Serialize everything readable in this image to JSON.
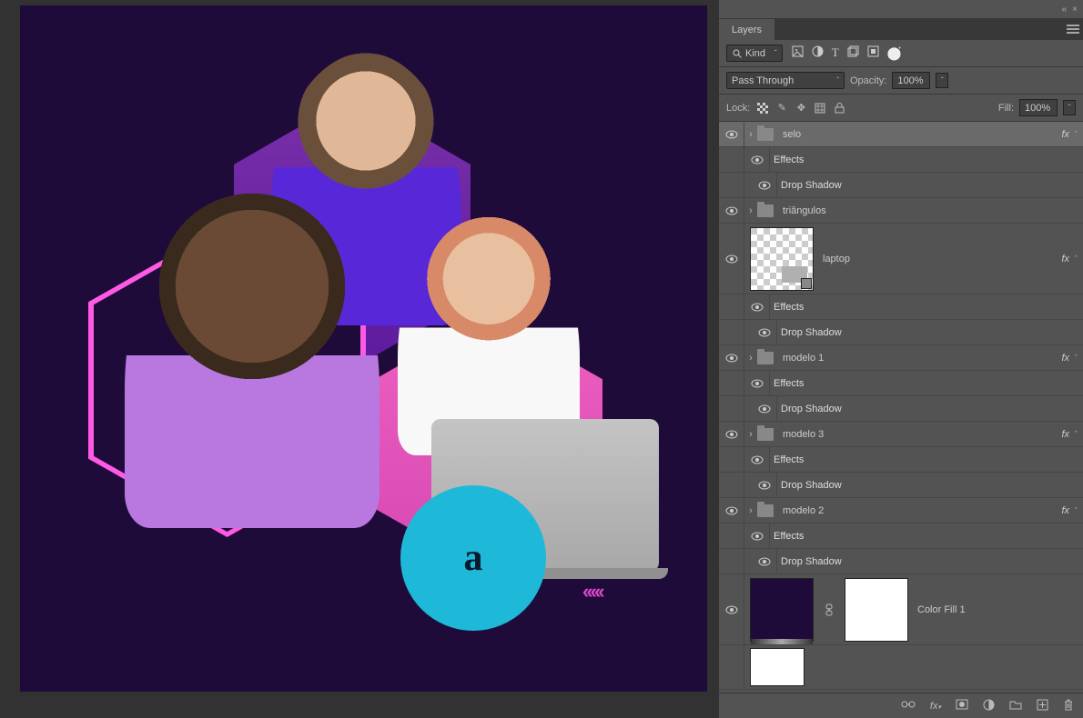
{
  "panel": {
    "tab": "Layers",
    "filter": {
      "kind": "Kind"
    },
    "blend": {
      "mode": "Pass Through",
      "opacity_label": "Opacity:",
      "opacity": "100%"
    },
    "lock": {
      "label": "Lock:",
      "fill_label": "Fill:",
      "fill": "100%"
    }
  },
  "layers": [
    {
      "name": "selo",
      "type": "group",
      "fx": true,
      "selected": true,
      "effects": [
        "Drop Shadow"
      ]
    },
    {
      "name": "triângulos",
      "type": "group",
      "fx": false
    },
    {
      "name": "laptop",
      "type": "smart",
      "fx": true,
      "effects": [
        "Drop Shadow"
      ]
    },
    {
      "name": "modelo 1",
      "type": "group",
      "fx": true,
      "effects": [
        "Drop Shadow"
      ]
    },
    {
      "name": "modelo 3",
      "type": "group",
      "fx": true,
      "effects": [
        "Drop Shadow"
      ]
    },
    {
      "name": "modelo 2",
      "type": "group",
      "fx": true,
      "effects": [
        "Drop Shadow"
      ]
    },
    {
      "name": "Color Fill 1",
      "type": "fill"
    }
  ],
  "effects_label": "Effects"
}
